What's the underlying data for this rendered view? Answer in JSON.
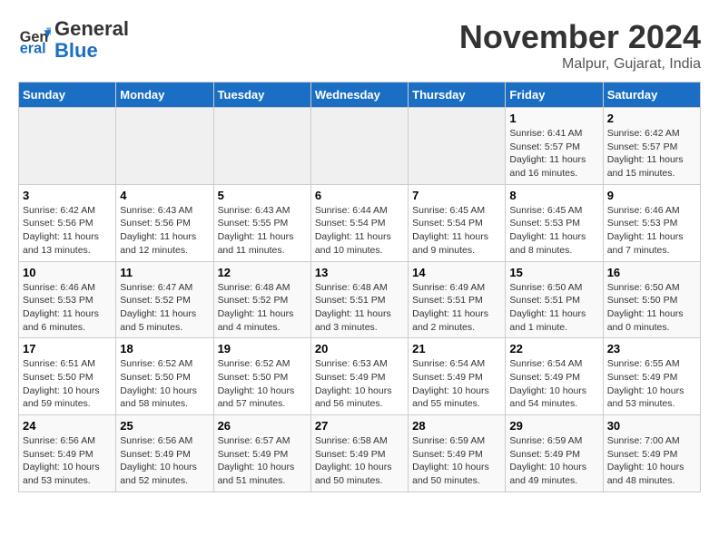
{
  "header": {
    "logo_line1": "General",
    "logo_line2": "Blue",
    "month": "November 2024",
    "location": "Malpur, Gujarat, India"
  },
  "weekdays": [
    "Sunday",
    "Monday",
    "Tuesday",
    "Wednesday",
    "Thursday",
    "Friday",
    "Saturday"
  ],
  "weeks": [
    [
      {
        "day": "",
        "info": ""
      },
      {
        "day": "",
        "info": ""
      },
      {
        "day": "",
        "info": ""
      },
      {
        "day": "",
        "info": ""
      },
      {
        "day": "",
        "info": ""
      },
      {
        "day": "1",
        "info": "Sunrise: 6:41 AM\nSunset: 5:57 PM\nDaylight: 11 hours\nand 16 minutes."
      },
      {
        "day": "2",
        "info": "Sunrise: 6:42 AM\nSunset: 5:57 PM\nDaylight: 11 hours\nand 15 minutes."
      }
    ],
    [
      {
        "day": "3",
        "info": "Sunrise: 6:42 AM\nSunset: 5:56 PM\nDaylight: 11 hours\nand 13 minutes."
      },
      {
        "day": "4",
        "info": "Sunrise: 6:43 AM\nSunset: 5:56 PM\nDaylight: 11 hours\nand 12 minutes."
      },
      {
        "day": "5",
        "info": "Sunrise: 6:43 AM\nSunset: 5:55 PM\nDaylight: 11 hours\nand 11 minutes."
      },
      {
        "day": "6",
        "info": "Sunrise: 6:44 AM\nSunset: 5:54 PM\nDaylight: 11 hours\nand 10 minutes."
      },
      {
        "day": "7",
        "info": "Sunrise: 6:45 AM\nSunset: 5:54 PM\nDaylight: 11 hours\nand 9 minutes."
      },
      {
        "day": "8",
        "info": "Sunrise: 6:45 AM\nSunset: 5:53 PM\nDaylight: 11 hours\nand 8 minutes."
      },
      {
        "day": "9",
        "info": "Sunrise: 6:46 AM\nSunset: 5:53 PM\nDaylight: 11 hours\nand 7 minutes."
      }
    ],
    [
      {
        "day": "10",
        "info": "Sunrise: 6:46 AM\nSunset: 5:53 PM\nDaylight: 11 hours\nand 6 minutes."
      },
      {
        "day": "11",
        "info": "Sunrise: 6:47 AM\nSunset: 5:52 PM\nDaylight: 11 hours\nand 5 minutes."
      },
      {
        "day": "12",
        "info": "Sunrise: 6:48 AM\nSunset: 5:52 PM\nDaylight: 11 hours\nand 4 minutes."
      },
      {
        "day": "13",
        "info": "Sunrise: 6:48 AM\nSunset: 5:51 PM\nDaylight: 11 hours\nand 3 minutes."
      },
      {
        "day": "14",
        "info": "Sunrise: 6:49 AM\nSunset: 5:51 PM\nDaylight: 11 hours\nand 2 minutes."
      },
      {
        "day": "15",
        "info": "Sunrise: 6:50 AM\nSunset: 5:51 PM\nDaylight: 11 hours\nand 1 minute."
      },
      {
        "day": "16",
        "info": "Sunrise: 6:50 AM\nSunset: 5:50 PM\nDaylight: 11 hours\nand 0 minutes."
      }
    ],
    [
      {
        "day": "17",
        "info": "Sunrise: 6:51 AM\nSunset: 5:50 PM\nDaylight: 10 hours\nand 59 minutes."
      },
      {
        "day": "18",
        "info": "Sunrise: 6:52 AM\nSunset: 5:50 PM\nDaylight: 10 hours\nand 58 minutes."
      },
      {
        "day": "19",
        "info": "Sunrise: 6:52 AM\nSunset: 5:50 PM\nDaylight: 10 hours\nand 57 minutes."
      },
      {
        "day": "20",
        "info": "Sunrise: 6:53 AM\nSunset: 5:49 PM\nDaylight: 10 hours\nand 56 minutes."
      },
      {
        "day": "21",
        "info": "Sunrise: 6:54 AM\nSunset: 5:49 PM\nDaylight: 10 hours\nand 55 minutes."
      },
      {
        "day": "22",
        "info": "Sunrise: 6:54 AM\nSunset: 5:49 PM\nDaylight: 10 hours\nand 54 minutes."
      },
      {
        "day": "23",
        "info": "Sunrise: 6:55 AM\nSunset: 5:49 PM\nDaylight: 10 hours\nand 53 minutes."
      }
    ],
    [
      {
        "day": "24",
        "info": "Sunrise: 6:56 AM\nSunset: 5:49 PM\nDaylight: 10 hours\nand 53 minutes."
      },
      {
        "day": "25",
        "info": "Sunrise: 6:56 AM\nSunset: 5:49 PM\nDaylight: 10 hours\nand 52 minutes."
      },
      {
        "day": "26",
        "info": "Sunrise: 6:57 AM\nSunset: 5:49 PM\nDaylight: 10 hours\nand 51 minutes."
      },
      {
        "day": "27",
        "info": "Sunrise: 6:58 AM\nSunset: 5:49 PM\nDaylight: 10 hours\nand 50 minutes."
      },
      {
        "day": "28",
        "info": "Sunrise: 6:59 AM\nSunset: 5:49 PM\nDaylight: 10 hours\nand 50 minutes."
      },
      {
        "day": "29",
        "info": "Sunrise: 6:59 AM\nSunset: 5:49 PM\nDaylight: 10 hours\nand 49 minutes."
      },
      {
        "day": "30",
        "info": "Sunrise: 7:00 AM\nSunset: 5:49 PM\nDaylight: 10 hours\nand 48 minutes."
      }
    ]
  ]
}
